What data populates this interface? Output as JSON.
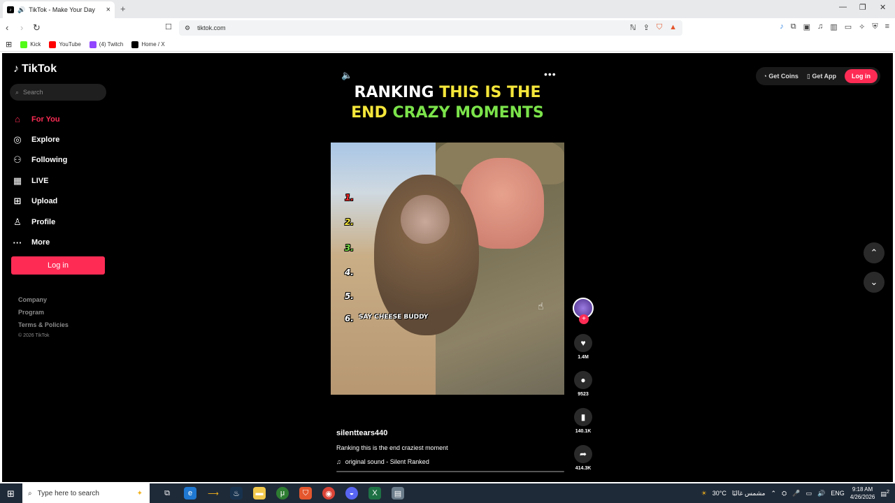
{
  "browser": {
    "tab_title": "TikTok - Make Your Day",
    "url": "tiktok.com",
    "bookmarks": [
      {
        "label": "Kick",
        "color": "#53fc18"
      },
      {
        "label": "YouTube",
        "color": "#ff0000"
      },
      {
        "label": "(4) Twitch",
        "color": "#9146ff"
      },
      {
        "label": "Home / X",
        "color": "#000000"
      }
    ]
  },
  "tiktok": {
    "brand": "TikTok",
    "search_placeholder": "Search",
    "nav": [
      {
        "label": "For You",
        "icon": "home-icon",
        "active": true
      },
      {
        "label": "Explore",
        "icon": "compass-icon"
      },
      {
        "label": "Following",
        "icon": "following-icon"
      },
      {
        "label": "LIVE",
        "icon": "live-icon"
      },
      {
        "label": "Upload",
        "icon": "upload-icon"
      },
      {
        "label": "Profile",
        "icon": "profile-icon"
      },
      {
        "label": "More",
        "icon": "more-icon"
      }
    ],
    "login_label": "Log in",
    "footer": {
      "company": "Company",
      "program": "Program",
      "terms": "Terms & Policies",
      "copyright": "© 2026 TikTok"
    },
    "topright": {
      "get_coins": "Get Coins",
      "get_app": "Get App",
      "login": "Log in"
    },
    "video": {
      "title_white1": "RANKING ",
      "title_yellow1": "THIS IS THE",
      "title_yellow2": "END ",
      "title_green": "CRAZY MOMENTS",
      "ranks": [
        "1.",
        "2.",
        "3.",
        "4.",
        "5.",
        "6."
      ],
      "rank_colors": [
        "#ff2b2b",
        "#f5e63a",
        "#7be34a",
        "#ffffff",
        "#ffffff",
        "#ffffff"
      ],
      "overlay_caption": "SAY CHEESE BUDDY",
      "username": "silenttears440",
      "description": "Ranking this is the end craziest moment",
      "sound": "original sound - Silent Ranked",
      "likes": "1.4M",
      "comments": "9523",
      "saves": "140.1K",
      "shares": "414.3K"
    },
    "accent": "#fe2c55"
  },
  "taskbar": {
    "search_placeholder": "Type here to search",
    "weather": "30°C",
    "weather_text": "مشمس غالبًا",
    "lang": "ENG",
    "time": "9:18 AM",
    "date": "4/26/2026",
    "notifications": "2"
  }
}
